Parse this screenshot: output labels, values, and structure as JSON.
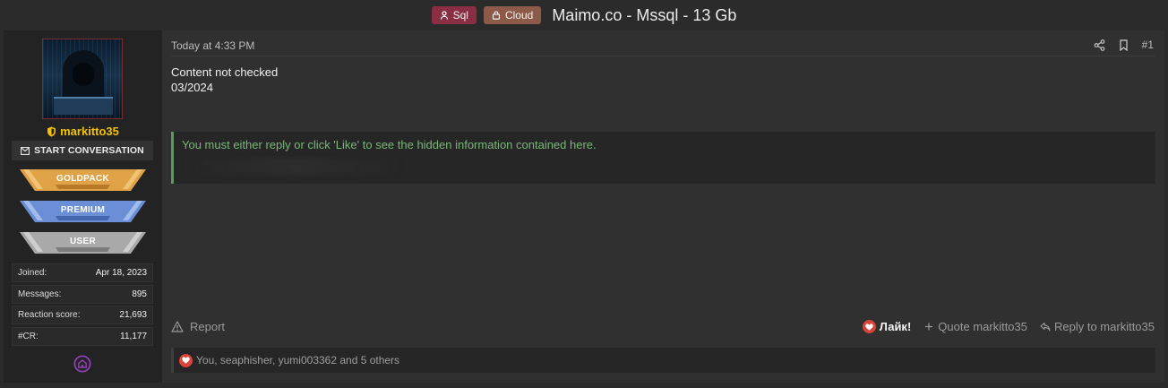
{
  "thread": {
    "tags": [
      {
        "label": "Sql",
        "icon": "user-icon",
        "color": "#8a2f43"
      },
      {
        "label": "Cloud",
        "icon": "lock-icon",
        "color": "#8c5a48"
      }
    ],
    "title": "Maimo.co - Mssql - 13 Gb"
  },
  "author": {
    "username": "markitto35",
    "username_color": "#f2c200",
    "start_conversation": "START CONVERSATION",
    "badges": [
      {
        "label": "GOLDPACK",
        "color": "#e0a246"
      },
      {
        "label": "PREMIUM",
        "color": "#6a8fd6"
      },
      {
        "label": "USER",
        "color": "#a9a9a9"
      }
    ],
    "stats": [
      {
        "label": "Joined:",
        "value": "Apr 18, 2023"
      },
      {
        "label": "Messages:",
        "value": "895"
      },
      {
        "label": "Reaction score:",
        "value": "21,693"
      },
      {
        "label": "#CR:",
        "value": "11,177"
      }
    ]
  },
  "post": {
    "date": "Today at 4:33 PM",
    "number": "#1",
    "body_lines": [
      "Content not checked",
      "03/2024"
    ],
    "hidden_notice": "You must either reply or click 'Like' to see the hidden information contained here.",
    "report_label": "Report",
    "like_label": "Лайк!",
    "quote_label": "Quote markitto35",
    "reply_label": "Reply to markitto35",
    "reactions_text": "You, seaphisher, yumi003362 and 5 others"
  },
  "colors": {
    "accent_green": "#4fa04f",
    "like_red": "#d8453a"
  }
}
